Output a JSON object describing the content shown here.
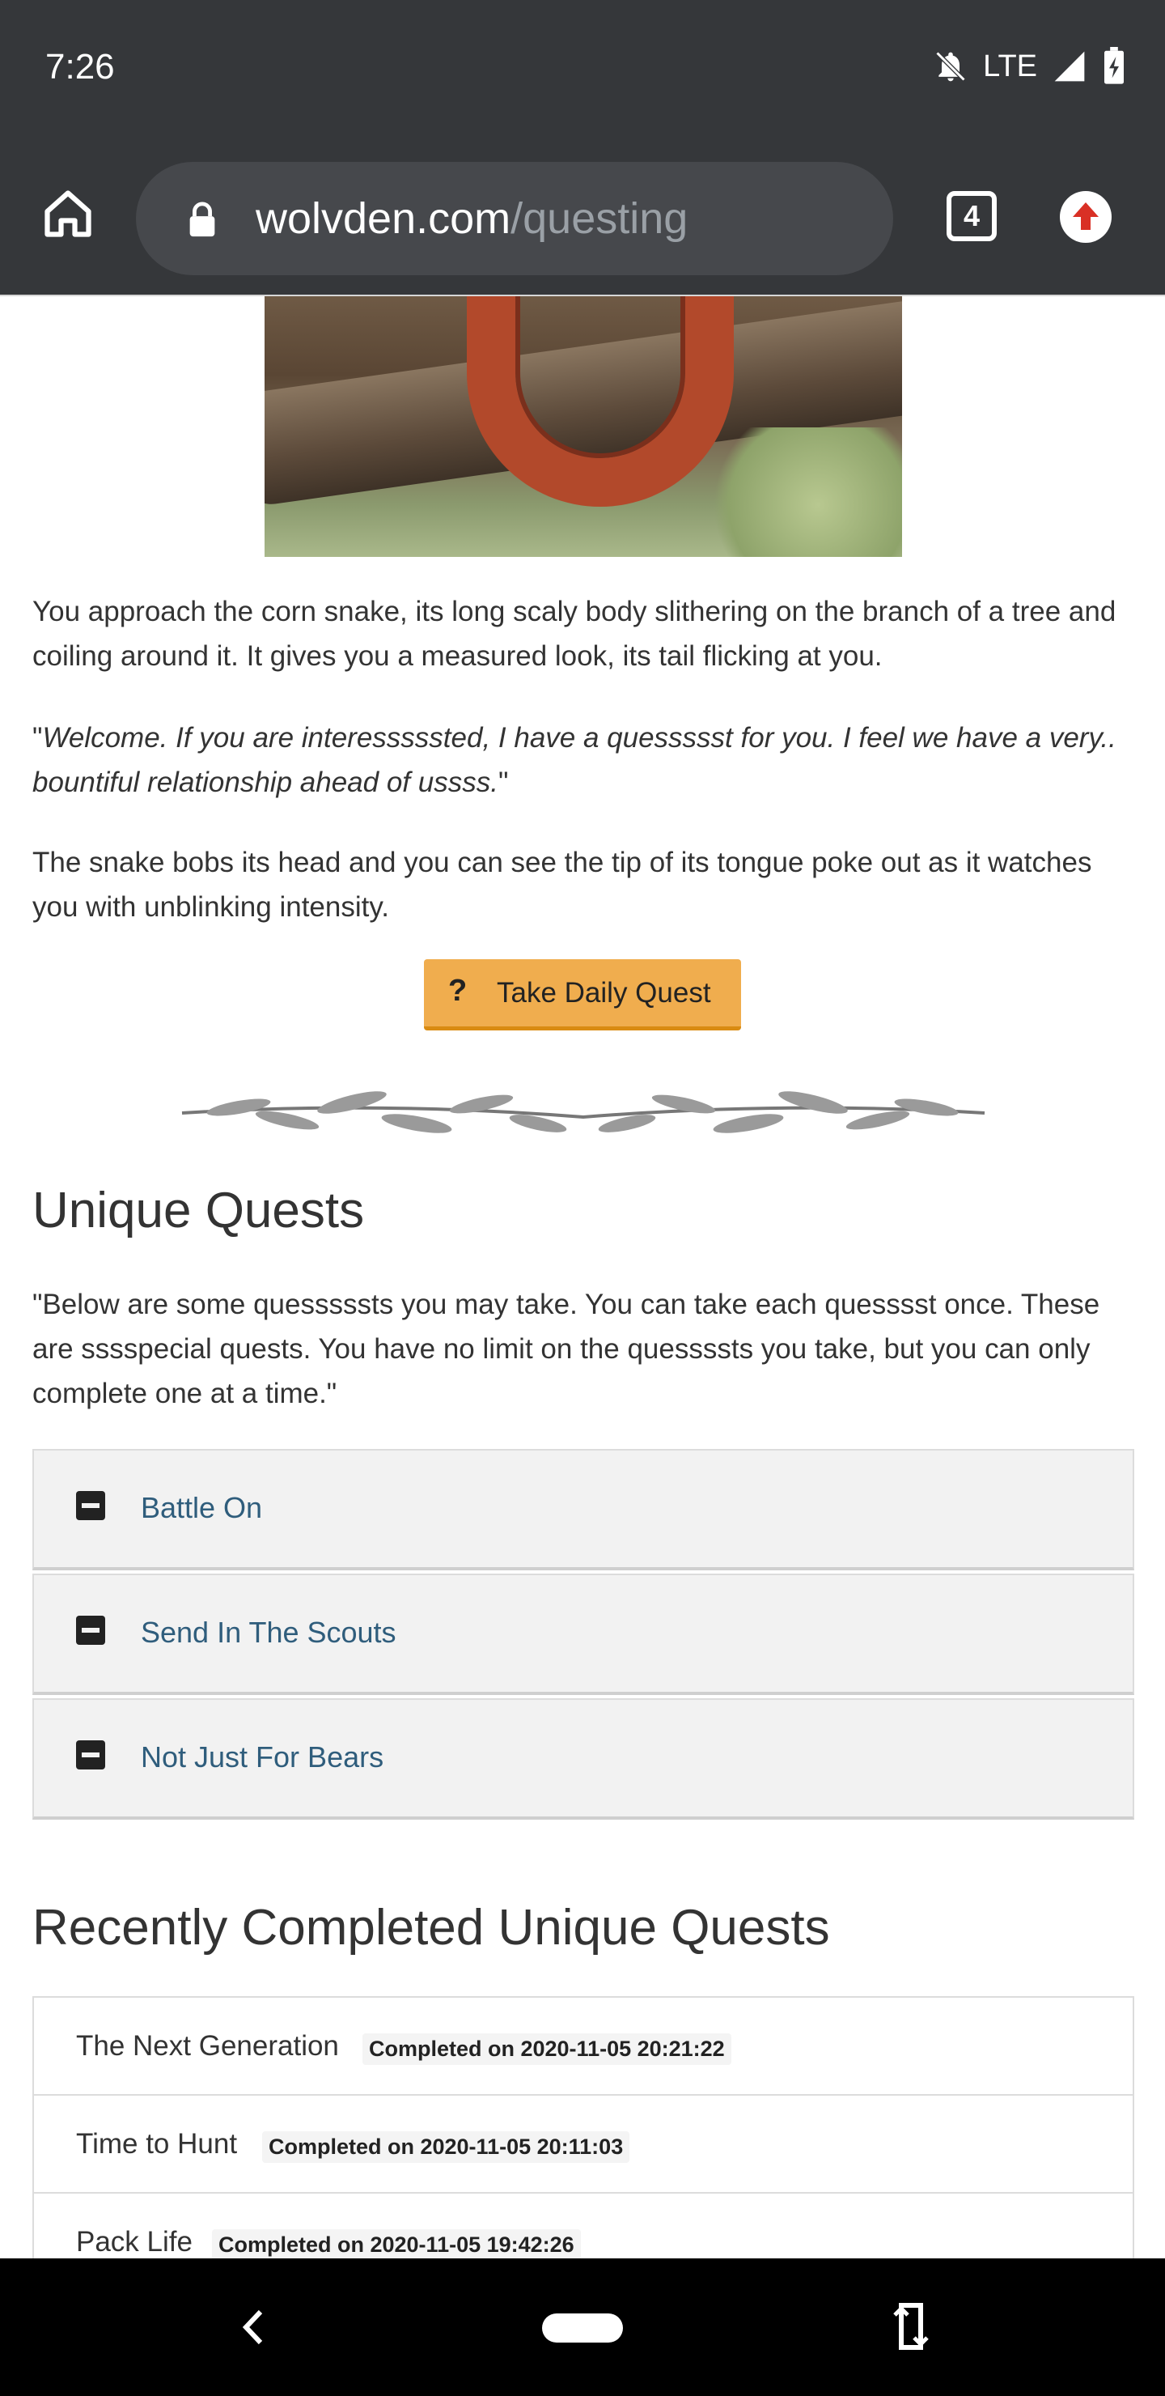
{
  "status_bar": {
    "time": "7:26",
    "network": "LTE"
  },
  "browser": {
    "url_domain": "wolvden.com",
    "url_path": "/questing",
    "tab_count": "4"
  },
  "intro": {
    "paragraph1": "You approach the corn snake, its long scaly body slithering on the branch of a tree and coiling around it. It gives you a measured look, its tail flicking at you.",
    "quote_open": "\"",
    "quote_text": "Welcome. If you are interesssssted, I have a quessssst for you. I feel we have a very.. bountiful relationship ahead of ussss.",
    "quote_close": "\"",
    "paragraph3": "The snake bobs its head and you can see the tip of its tongue poke out as it watches you with unblinking intensity."
  },
  "daily_quest_button": {
    "icon": "?",
    "label": "Take Daily Quest"
  },
  "unique_quests": {
    "heading": "Unique Quests",
    "description": "\"Below are some quesssssts you may take. You can take each quesssst once. These are sssspecial quests. You have no limit on the quessssts you take, but you can only complete one at a time.\"",
    "items": [
      {
        "title": "Battle On"
      },
      {
        "title": "Send In The Scouts"
      },
      {
        "title": "Not Just For Bears"
      }
    ]
  },
  "recently_completed": {
    "heading": "Recently Completed Unique Quests",
    "items": [
      {
        "name": "The Next Generation",
        "completed": "Completed on 2020-11-05 20:21:22"
      },
      {
        "name": "Time to Hunt",
        "completed": "Completed on 2020-11-05 20:11:03"
      },
      {
        "name": "Pack Life",
        "completed": "Completed on 2020-11-05 19:42:26"
      }
    ]
  },
  "colors": {
    "button_orange": "#f0ad4e",
    "link_blue": "#2f5d7c",
    "chrome_dark": "#35373a"
  }
}
